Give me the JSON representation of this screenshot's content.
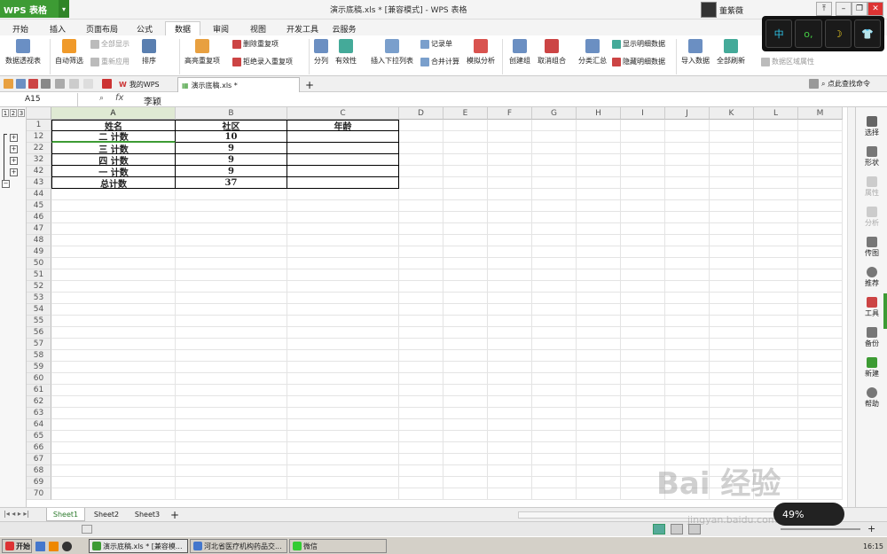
{
  "app": {
    "name": "WPS 表格",
    "window_title": "演示底稿.xls * [兼容模式] - WPS 表格",
    "user": "董紫薇"
  },
  "menu_tabs": [
    "开始",
    "插入",
    "页面布局",
    "公式",
    "数据",
    "审阅",
    "视图",
    "开发工具",
    "云服务"
  ],
  "dark_panel": [
    "中",
    "o,",
    "☽",
    "👕"
  ],
  "ribbon": {
    "pivot": "数据透视表",
    "auto_filter": "自动筛选",
    "show_all": "全部显示",
    "reapply": "重新应用",
    "sort": "排序",
    "highlight_dup": "高亮重复项",
    "delete_dup": "删除重复项",
    "reject_dup": "拒绝录入重复项",
    "split": "分列",
    "validity": "有效性",
    "insert_dropdown": "插入下拉列表",
    "record": "记录单",
    "merge_calc": "合并计算",
    "simulate": "模拟分析",
    "create_group": "创建组",
    "ungroup": "取消组合",
    "subtotal": "分类汇总",
    "show_detail": "显示明细数据",
    "hide_detail": "隐藏明细数据",
    "import": "导入数据",
    "refresh_all": "全部刷新",
    "region_prop": "数据区域属性"
  },
  "doc_tabs": [
    "我的WPS",
    "演示底稿.xls *"
  ],
  "search_cmd": "点此查找命令",
  "formula_bar": {
    "cell_ref": "A15",
    "fx": "fx",
    "value": "李颖"
  },
  "outline_levels": [
    "1",
    "2",
    "3"
  ],
  "columns": [
    "A",
    "B",
    "C",
    "D",
    "E",
    "F",
    "G",
    "H",
    "I",
    "J",
    "K",
    "L",
    "M"
  ],
  "rows": [
    {
      "num": "1",
      "a": "姓名",
      "b": "社区",
      "c": "年龄"
    },
    {
      "num": "12",
      "a": "二 计数",
      "b": "10",
      "c": ""
    },
    {
      "num": "22",
      "a": "三 计数",
      "b": "9",
      "c": ""
    },
    {
      "num": "32",
      "a": "四 计数",
      "b": "9",
      "c": ""
    },
    {
      "num": "42",
      "a": "一 计数",
      "b": "9",
      "c": ""
    },
    {
      "num": "43",
      "a": "总计数",
      "b": "37",
      "c": ""
    },
    {
      "num": "44"
    },
    {
      "num": "45"
    },
    {
      "num": "46"
    },
    {
      "num": "47"
    },
    {
      "num": "48"
    },
    {
      "num": "49"
    },
    {
      "num": "50"
    },
    {
      "num": "51"
    },
    {
      "num": "52"
    },
    {
      "num": "53"
    },
    {
      "num": "54"
    },
    {
      "num": "55"
    },
    {
      "num": "56"
    },
    {
      "num": "57"
    },
    {
      "num": "58"
    },
    {
      "num": "59"
    },
    {
      "num": "60"
    },
    {
      "num": "61"
    },
    {
      "num": "62"
    },
    {
      "num": "63"
    },
    {
      "num": "64"
    },
    {
      "num": "65"
    },
    {
      "num": "66"
    },
    {
      "num": "67"
    },
    {
      "num": "68"
    },
    {
      "num": "69"
    },
    {
      "num": "70"
    }
  ],
  "right_panel": [
    "选择",
    "形状",
    "属性",
    "分析",
    "传图",
    "推荐",
    "工具",
    "备份",
    "新建",
    "帮助"
  ],
  "sheets": [
    "Sheet1",
    "Sheet2",
    "Sheet3"
  ],
  "zoom_percent": "49%",
  "watermark": {
    "main": "Bai 经验",
    "sub": "jingyan.baidu.com"
  },
  "taskbar": {
    "start": "开始",
    "items": [
      "演示底稿.xls * [兼容模...",
      "河北省医疗机构药品交...",
      "微信"
    ],
    "time": "16:15"
  },
  "colors": {
    "wps_green": "#3d9b34",
    "accent": "#2c7a2c"
  }
}
